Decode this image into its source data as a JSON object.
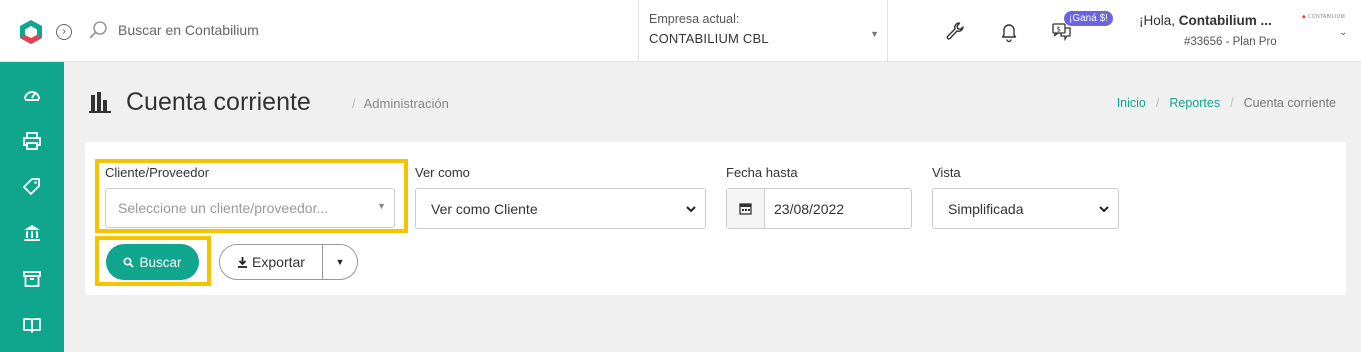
{
  "header": {
    "search_placeholder": "Buscar en Contabilium",
    "company_label": "Empresa actual:",
    "company_value": "CONTABILIUM CBL",
    "promo_badge": "¡Ganá $!",
    "greeting_prefix": "¡Hola, ",
    "greeting_name": "Contabilium ...",
    "account_info": "#33656 - Plan Pro",
    "mini_logo_text": "CONTABILIUM"
  },
  "sidebar": {
    "items": [
      "dashboard-icon",
      "printer-icon",
      "tag-icon",
      "bank-icon",
      "archive-icon",
      "book-icon"
    ]
  },
  "page": {
    "title": "Cuenta corriente",
    "subtitle": "Administración",
    "breadcrumb": [
      "Inicio",
      "Reportes",
      "Cuenta corriente"
    ]
  },
  "filters": {
    "client_label": "Cliente/Proveedor",
    "client_placeholder": "Seleccione un cliente/proveedor...",
    "view_as_label": "Ver como",
    "view_as_value": "Ver como Cliente",
    "date_label": "Fecha hasta",
    "date_value": "23/08/2022",
    "vista_label": "Vista",
    "vista_value": "Simplificada"
  },
  "actions": {
    "search_label": "Buscar",
    "export_label": "Exportar"
  },
  "colors": {
    "brand": "#10a58d",
    "highlight": "#f5c400",
    "badge": "#6c63e0"
  }
}
